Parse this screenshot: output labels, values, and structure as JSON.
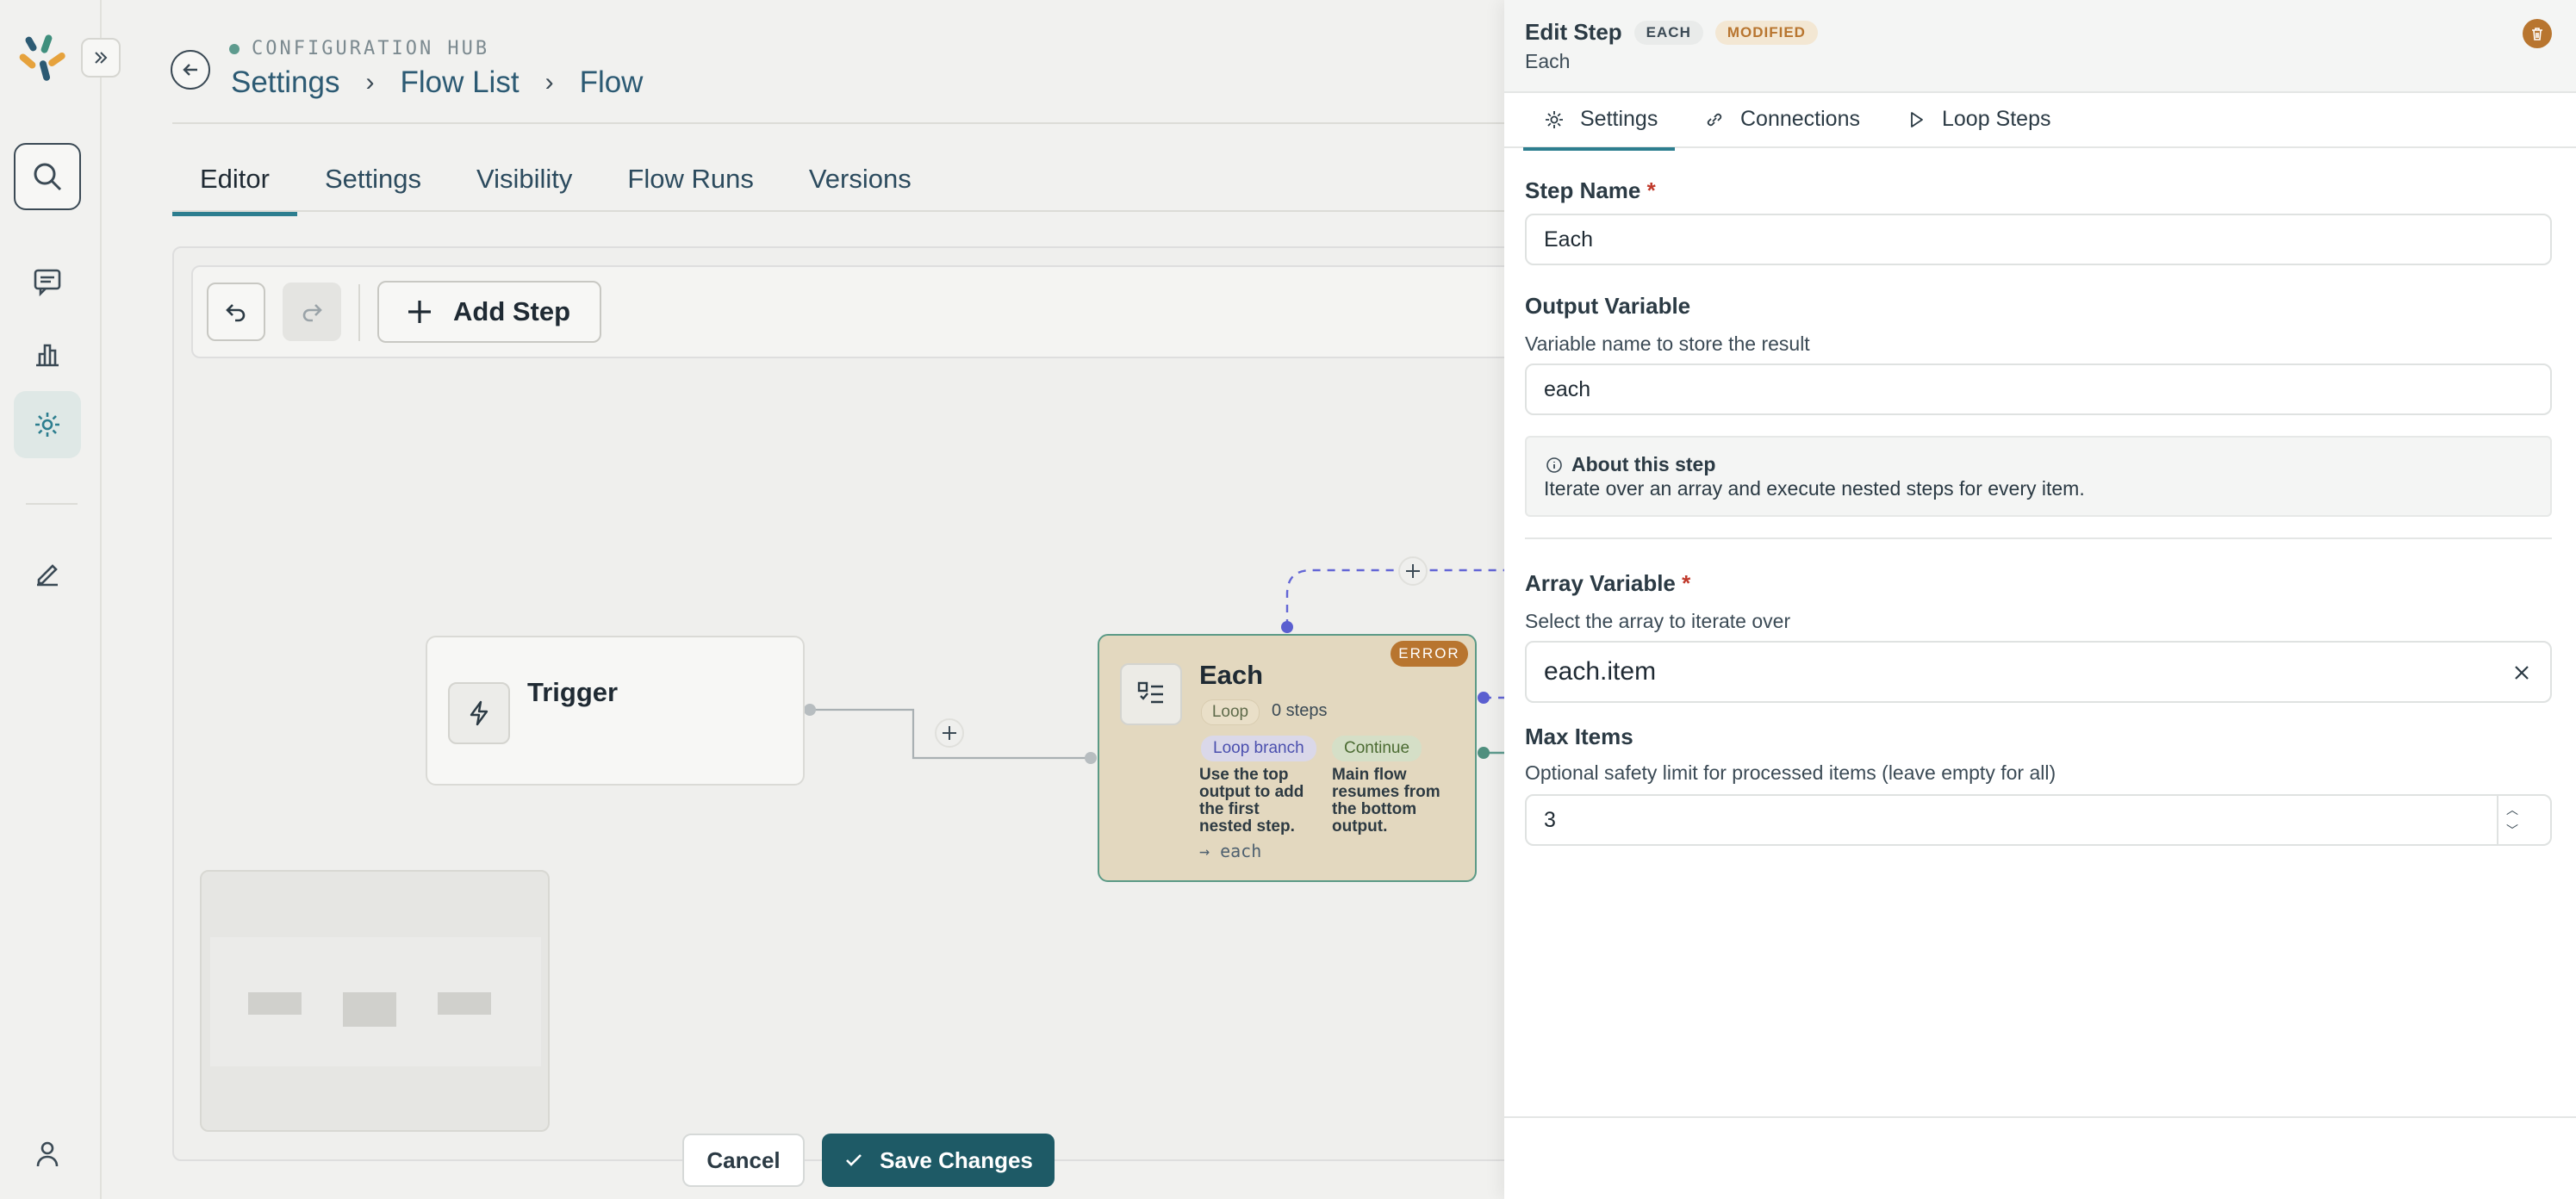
{
  "header": {
    "hub_label": "CONFIGURATION HUB",
    "breadcrumbs": [
      "Settings",
      "Flow List",
      "Flow"
    ]
  },
  "tabs": [
    {
      "label": "Editor",
      "active": true
    },
    {
      "label": "Settings",
      "active": false
    },
    {
      "label": "Visibility",
      "active": false
    },
    {
      "label": "Flow Runs",
      "active": false
    },
    {
      "label": "Versions",
      "active": false
    }
  ],
  "toolbar": {
    "undo_icon": "undo-icon",
    "redo_icon": "redo-icon",
    "add_step_label": "Add Step"
  },
  "nodes": {
    "trigger": {
      "title": "Trigger",
      "icon": "lightning-icon"
    },
    "each": {
      "title": "Each",
      "status_badge": "ERROR",
      "type_pill": "Loop",
      "steps": "0 steps",
      "loop_branch": {
        "pill": "Loop branch",
        "text": [
          "Use the top",
          "output to add",
          "the first",
          "nested step."
        ]
      },
      "continue": {
        "pill": "Continue",
        "text": [
          "Main flow",
          "resumes from",
          "the bottom",
          "output."
        ]
      },
      "output": "→ each"
    }
  },
  "panel": {
    "title": "Edit Step",
    "badge_type": "EACH",
    "badge_state": "MODIFIED",
    "subtitle": "Each",
    "tabs": [
      {
        "label": "Settings",
        "icon": "gear-icon",
        "active": true
      },
      {
        "label": "Connections",
        "icon": "link-icon",
        "active": false
      },
      {
        "label": "Loop Steps",
        "icon": "play-icon",
        "active": false
      }
    ],
    "step_name": {
      "label": "Step Name",
      "required": "*",
      "value": "Each"
    },
    "output_variable": {
      "label": "Output Variable",
      "hint": "Variable name to store the result",
      "value": "each"
    },
    "about": {
      "title": "About this step",
      "text": "Iterate over an array and execute nested steps for every item."
    },
    "array_variable": {
      "label": "Array Variable",
      "required": "*",
      "hint": "Select the array to iterate over",
      "value": "each.item"
    },
    "max_items": {
      "label": "Max Items",
      "hint": "Optional safety limit for processed items (leave empty for all)",
      "value": "3"
    },
    "cancel_label": "Cancel",
    "save_label": "Save Changes"
  },
  "colors": {
    "accent": "#2d7e8f",
    "save_button": "#1e5a66",
    "error": "#b8752f",
    "loop_edge": "#6366d6"
  }
}
